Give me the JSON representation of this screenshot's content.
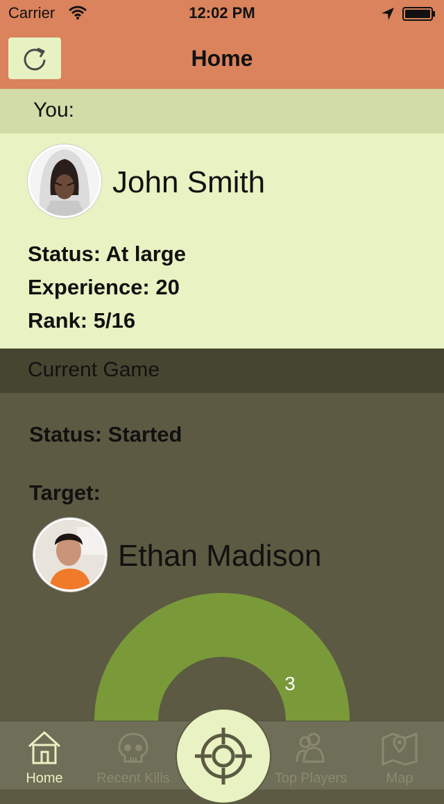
{
  "status_bar": {
    "carrier": "Carrier",
    "time": "12:02 PM"
  },
  "nav": {
    "title": "Home",
    "refresh_icon": "refresh-icon"
  },
  "you": {
    "header": "You:",
    "name": "John Smith",
    "status": "Status: At large",
    "experience": "Experience: 20",
    "rank": "Rank: 5/16"
  },
  "game": {
    "header": "Current Game",
    "status": "Status: Started",
    "target_label": "Target:",
    "target_name": "Ethan Madison",
    "gauge_value": "3"
  },
  "tabs": [
    {
      "label": "Home",
      "icon": "house-icon",
      "active": true
    },
    {
      "label": "Recent Kills",
      "icon": "skull-icon",
      "active": false
    },
    {
      "label": "",
      "icon": "crosshair-icon",
      "active": false
    },
    {
      "label": "Top Players",
      "icon": "people-icon",
      "active": false
    },
    {
      "label": "Map",
      "icon": "map-icon",
      "active": false
    }
  ],
  "colors": {
    "nav_bg": "#da835c",
    "you_header_bg": "#d1dca8",
    "you_card_bg": "#e8f2c2",
    "game_header_bg": "#464530",
    "game_bg": "#5c5a42",
    "gauge_green": "#7a9a3a"
  }
}
